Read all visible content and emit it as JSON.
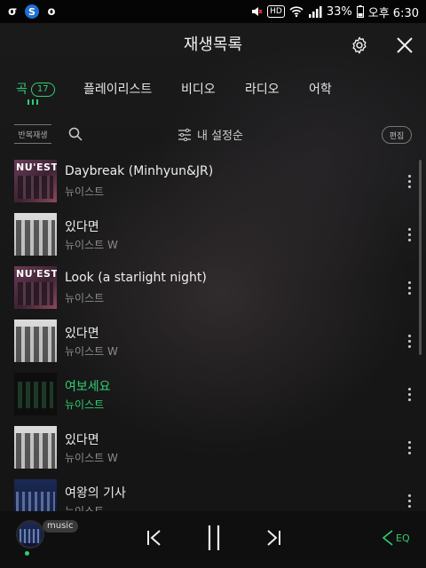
{
  "status_bar": {
    "battery": "33%",
    "time": "오후 6:30",
    "hd": "HD"
  },
  "header": {
    "title": "재생목록"
  },
  "tabs": [
    {
      "label": "곡",
      "count": "17",
      "active": true
    },
    {
      "label": "플레이리스트"
    },
    {
      "label": "비디오"
    },
    {
      "label": "라디오"
    },
    {
      "label": "어학"
    }
  ],
  "toolbar": {
    "repeat_label": "반복재생",
    "sort_label": "내 설정순",
    "edit_label": "편집"
  },
  "songs": [
    {
      "title": "Daybreak (Minhyun&JR)",
      "artist": "뉴이스트",
      "cover": "nuest-pink"
    },
    {
      "title": "있다면",
      "artist": "뉴이스트 W",
      "cover": "nuest-w-gray"
    },
    {
      "title": "Look (a starlight night)",
      "artist": "뉴이스트",
      "cover": "nuest-pink"
    },
    {
      "title": "있다면",
      "artist": "뉴이스트 W",
      "cover": "nuest-w-gray"
    },
    {
      "title": "여보세요",
      "artist": "뉴이스트",
      "cover": "nuest-dark",
      "playing": true
    },
    {
      "title": "있다면",
      "artist": "뉴이스트 W",
      "cover": "nuest-w-gray"
    },
    {
      "title": "여왕의 기사",
      "artist": "뉴이스트",
      "cover": "nuest-blue"
    }
  ],
  "player": {
    "badge": "music",
    "eq_label": "EQ"
  },
  "colors": {
    "accent": "#2fd072",
    "background": "#161616"
  },
  "icons": [
    "gear-icon",
    "close-icon",
    "search-icon",
    "sort-icon",
    "more-icon",
    "previous-icon",
    "pause-icon",
    "next-icon",
    "eq-icon",
    "repeat-icon",
    "wifi-icon",
    "signal-icon",
    "battery-icon",
    "volume-icon",
    "alarm-icon"
  ]
}
